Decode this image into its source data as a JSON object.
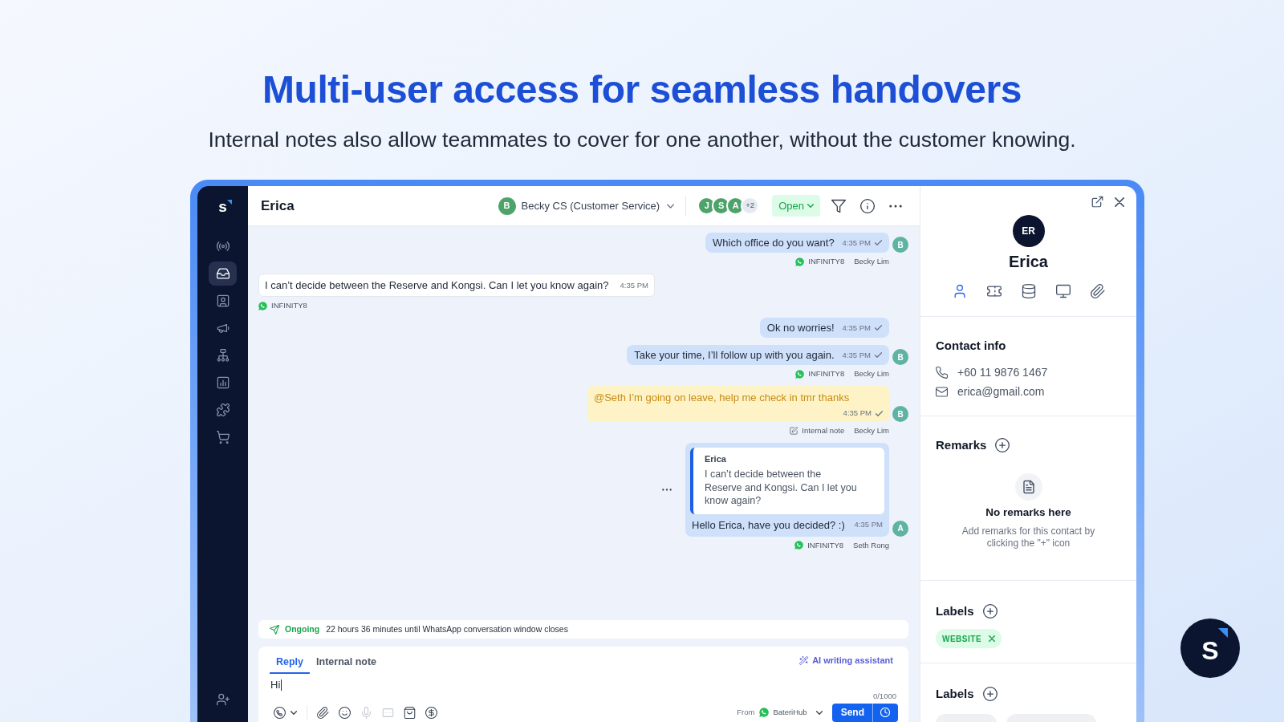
{
  "hero": {
    "title": "Multi-user access for seamless handovers",
    "subtitle": "Internal notes also allow teammates to cover for one another, without the customer knowing."
  },
  "sidebar": {
    "logo": "s",
    "items": [
      {
        "kind": "antenna",
        "selected": false
      },
      {
        "kind": "inbox",
        "selected": true
      },
      {
        "kind": "contact",
        "selected": false
      },
      {
        "kind": "megaphone",
        "selected": false
      },
      {
        "kind": "hierarchy",
        "selected": false
      },
      {
        "kind": "chart",
        "selected": false
      },
      {
        "kind": "puzzle",
        "selected": false
      },
      {
        "kind": "cart",
        "selected": false
      }
    ],
    "bottom_items": [
      {
        "kind": "adduser",
        "selected": false
      }
    ]
  },
  "conversation": {
    "contact_name": "Erica",
    "assignee": {
      "initial": "B",
      "name": "Becky CS (Customer Service)"
    },
    "participants": [
      {
        "initial": "J"
      },
      {
        "initial": "S"
      },
      {
        "initial": "A"
      }
    ],
    "participants_more": "+2",
    "status": "Open",
    "messages": [
      {
        "kind": "outgoing",
        "text": "Which office do you want?",
        "time": "4:35 PM",
        "ticked": true,
        "avatar": "B",
        "source": "INFINITY8",
        "agent": "Becky Lim"
      },
      {
        "kind": "incoming",
        "text": "I can’t decide between the Reserve and Kongsi. Can I let you know again?",
        "time": "4:35 PM",
        "ticked": false,
        "source": "INFINITY8"
      },
      {
        "kind": "outgoing",
        "text": "Ok no worries!",
        "time": "4:35 PM",
        "ticked": true
      },
      {
        "kind": "outgoing",
        "text": "Take your time, I’ll follow up with you again.",
        "time": "4:35 PM",
        "ticked": true,
        "avatar": "B",
        "source": "INFINITY8",
        "agent": "Becky Lim"
      },
      {
        "kind": "note",
        "text": "@Seth I’m going on leave, help me check in tmr thanks",
        "time": "4:35 PM",
        "ticked": true,
        "avatar": "B",
        "source": "Internal note",
        "agent": "Becky Lim"
      },
      {
        "kind": "reply",
        "quote": {
          "author": "Erica",
          "text": "I can’t decide between the Reserve and Kongsi. Can I let you know again?"
        },
        "text": "Hello Erica, have you decided? :)",
        "time": "4:35 PM",
        "ticked": false,
        "avatar": "A",
        "source": "INFINITY8",
        "agent": "Seth Rong"
      }
    ]
  },
  "composer": {
    "status_label": "Ongoing",
    "status_text": "22 hours 36 minutes until WhatsApp conversation window closes",
    "tabs": [
      {
        "label": "Reply",
        "selected": true
      },
      {
        "label": "Internal note",
        "selected": false
      }
    ],
    "ai_assistant": "AI writing assistant",
    "value": "Hi",
    "counter": "0/1000",
    "tools": [
      {
        "kind": "phone",
        "disabled": false
      },
      {
        "kind": "attach",
        "disabled": false
      },
      {
        "kind": "emoji",
        "disabled": false
      },
      {
        "kind": "mic",
        "disabled": true
      },
      {
        "kind": "message",
        "disabled": true
      },
      {
        "kind": "bag",
        "disabled": false
      },
      {
        "kind": "payment",
        "disabled": false
      }
    ],
    "from_label": "From",
    "from_channel": "BateriHub",
    "send": "Send"
  },
  "contact_panel": {
    "initials": "ER",
    "name": "Erica",
    "tabs": [
      {
        "kind": "person",
        "selected": true
      },
      {
        "kind": "ticket",
        "selected": false
      },
      {
        "kind": "database",
        "selected": false
      },
      {
        "kind": "monitor",
        "selected": false
      },
      {
        "kind": "paperclip",
        "selected": false
      }
    ],
    "contact_info": {
      "title": "Contact info",
      "phone": "+60 11 9876 1467",
      "email": "erica@gmail.com"
    },
    "remarks": {
      "title": "Remarks",
      "empty_title": "No remarks here",
      "empty_text": "Add remarks for this contact by clicking the \"+\" icon"
    },
    "labels": {
      "title": "Labels",
      "items": [
        {
          "text": "WEBSITE"
        }
      ]
    },
    "labels_2": {
      "title": "Labels"
    }
  },
  "floating_logo": {
    "letter": "S"
  }
}
